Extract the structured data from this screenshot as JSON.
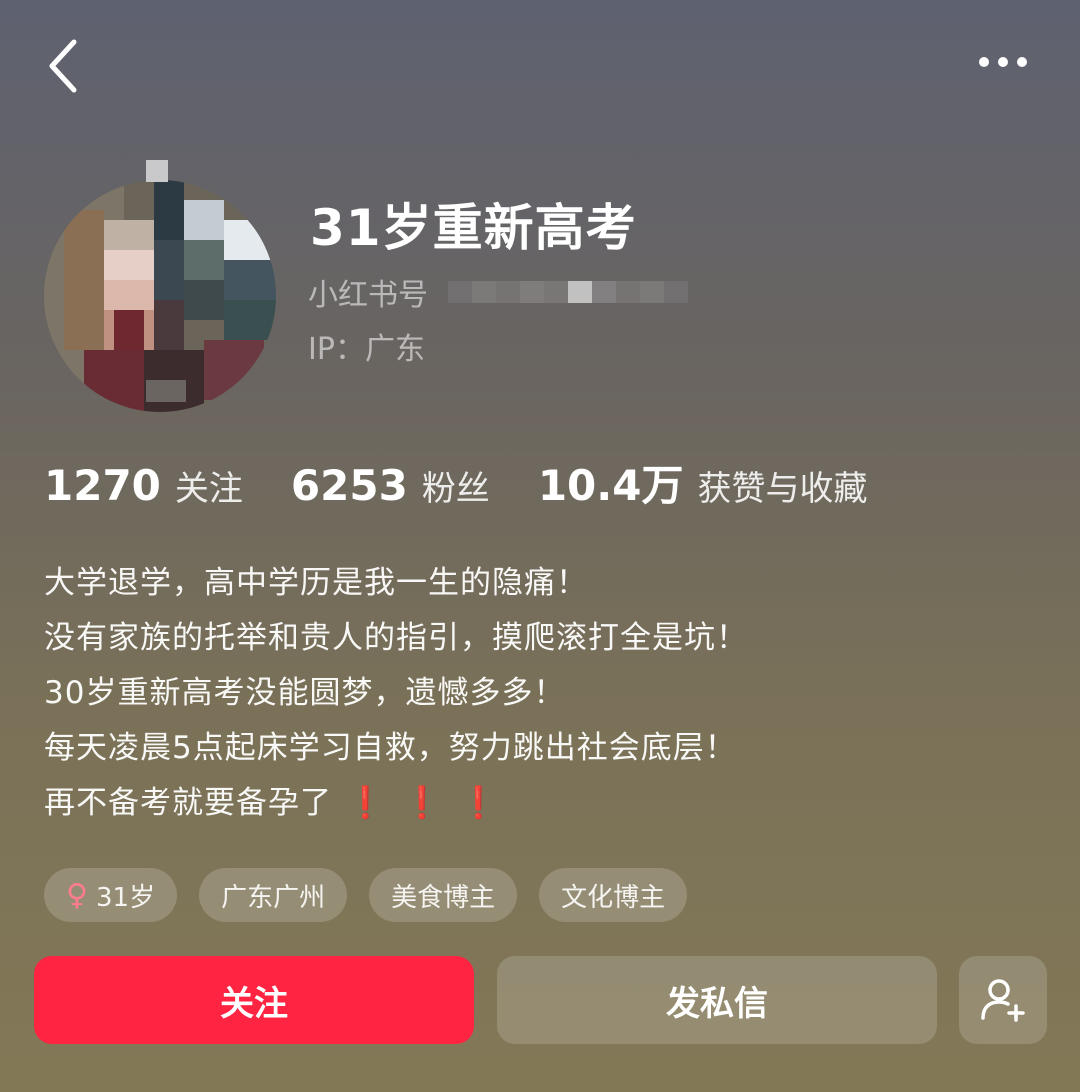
{
  "profile": {
    "name": "31岁重新高考",
    "redbook_id_label": "小红书号",
    "ip_label": "IP：广东"
  },
  "icons": {
    "back": "chevron-left-icon",
    "more": "more-horizontal-icon",
    "add_user": "add-user-icon",
    "female": "female-icon"
  },
  "stats": [
    {
      "value": "1270",
      "label": "关注"
    },
    {
      "value": "6253",
      "label": "粉丝"
    },
    {
      "value": "10.4万",
      "label": "获赞与收藏"
    }
  ],
  "bio": [
    "大学退学，高中学历是我一生的隐痛！",
    "没有家族的托举和贵人的指引，摸爬滚打全是坑！",
    "30岁重新高考没能圆梦，遗憾多多！",
    "每天凌晨5点起床学习自救，努力跳出社会底层！",
    "再不备考就要备孕了"
  ],
  "bio_emoji": "❗❗❗",
  "tags": [
    {
      "label": "31岁",
      "icon": "♀"
    },
    {
      "label": "广东广州"
    },
    {
      "label": "美食博主"
    },
    {
      "label": "文化博主"
    }
  ],
  "actions": {
    "follow_label": "关注",
    "message_label": "发私信"
  },
  "colors": {
    "accent": "#ff2442",
    "exclaim": "#d6121c"
  }
}
